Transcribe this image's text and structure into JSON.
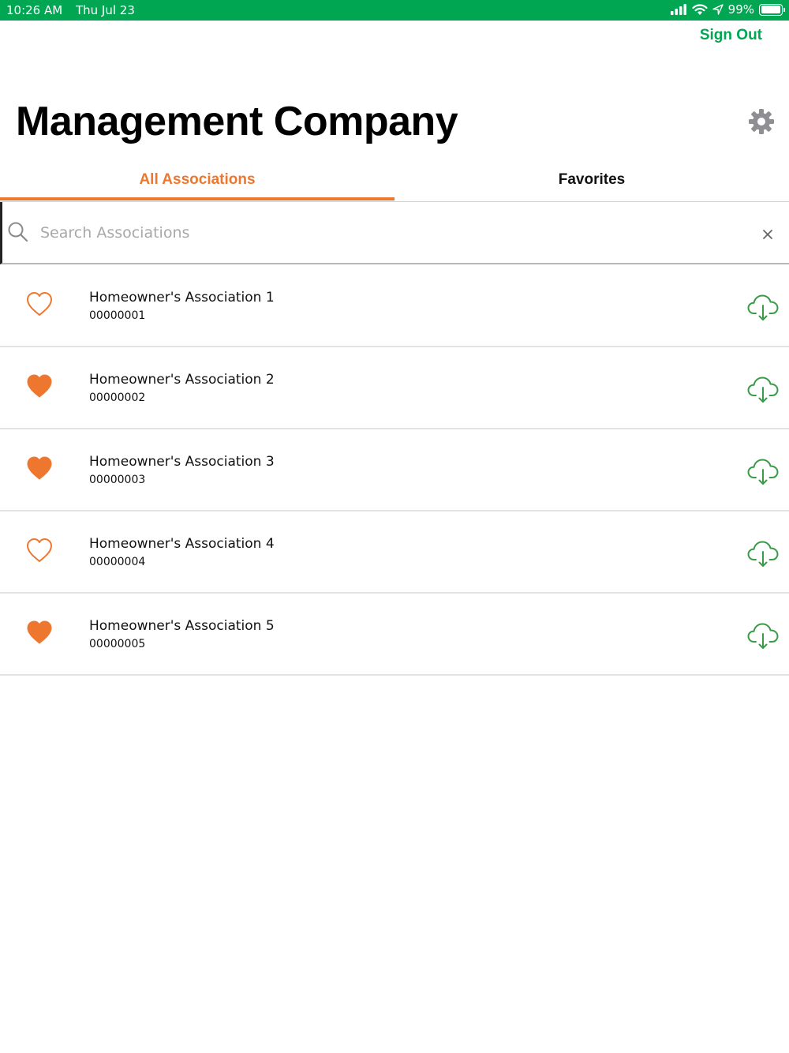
{
  "status_bar": {
    "time": "10:26 AM",
    "date": "Thu Jul 23",
    "battery_percent": "99%",
    "battery_level": 0.99,
    "icons": [
      "cellular-signal-icon",
      "wifi-icon",
      "location-arrow-icon",
      "battery-icon"
    ]
  },
  "header": {
    "sign_out_label": "Sign Out",
    "title": "Management Company",
    "settings_icon": "gear-icon"
  },
  "tabs": [
    {
      "label": "All Associations",
      "selected": true
    },
    {
      "label": "Favorites",
      "selected": false
    }
  ],
  "search": {
    "placeholder": "Search Associations",
    "value": "",
    "icon": "search-icon",
    "clear_icon": "close-icon"
  },
  "associations": [
    {
      "name": "Homeowner's Association 1",
      "number": "00000001",
      "favorite": false
    },
    {
      "name": "Homeowner's Association 2",
      "number": "00000002",
      "favorite": true
    },
    {
      "name": "Homeowner's Association 3",
      "number": "00000003",
      "favorite": true
    },
    {
      "name": "Homeowner's Association 4",
      "number": "00000004",
      "favorite": false
    },
    {
      "name": "Homeowner's Association 5",
      "number": "00000005",
      "favorite": true
    }
  ],
  "colors": {
    "brand_green": "#00a651",
    "accent_orange": "#ee7730",
    "download_green": "#3a9a48",
    "gear_gray": "#8e8e93"
  }
}
